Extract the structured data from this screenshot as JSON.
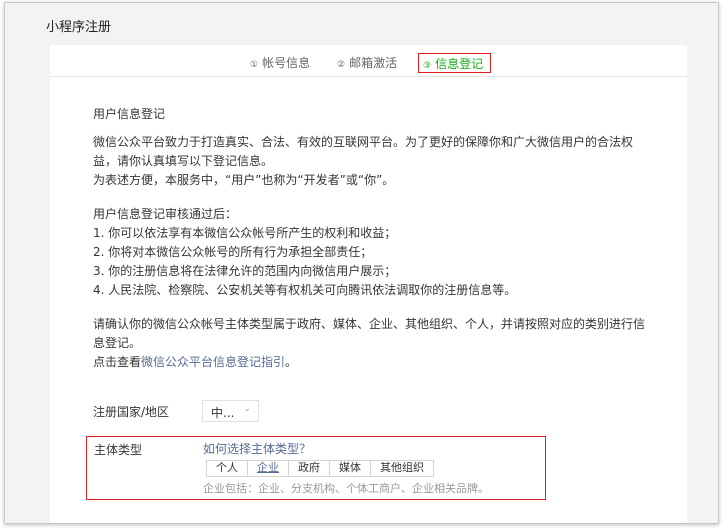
{
  "page": {
    "title": "小程序注册"
  },
  "steps": [
    {
      "num": "①",
      "label": "帐号信息"
    },
    {
      "num": "②",
      "label": "邮箱激活"
    },
    {
      "num": "③",
      "label": "信息登记"
    }
  ],
  "colors": {
    "active_step": "#1aad19",
    "link": "#576b95",
    "highlight_border": "#e02020"
  },
  "intro": {
    "title": "用户信息登记",
    "p1": "微信公众平台致力于打造真实、合法、有效的互联网平台。为了更好的保障你和广大微信用户的合法权益，请你认真填写以下登记信息。",
    "p2": "为表述方便，本服务中，“用户”也称为“开发者”或“你”。",
    "after_title": "用户信息登记审核通过后：",
    "items": [
      "1. 你可以依法享有本微信公众帐号所产生的权利和收益；",
      "2. 你将对本微信公众帐号的所有行为承担全部责任；",
      "3. 你的注册信息将在法律允许的范围内向微信用户展示；",
      "4. 人民法院、检察院、公安机关等有权机关可向腾讯依法调取你的注册信息等。"
    ],
    "confirm": "请确认你的微信公众帐号主体类型属于政府、媒体、企业、其他组织、个人，并请按照对应的类别进行信息登记。",
    "guide_prefix": "点击查看",
    "guide_link": "微信公众平台信息登记指引",
    "guide_suffix": "。"
  },
  "region": {
    "label": "注册国家/地区",
    "value": "中...",
    "icon": "chevron-down-icon"
  },
  "subject": {
    "label": "主体类型",
    "help_link": "如何选择主体类型？",
    "tabs": [
      "个人",
      "企业",
      "政府",
      "媒体",
      "其他组织"
    ],
    "active_tab": "企业",
    "description": "企业包括：企业、分支机构、个体工商户、企业相关品牌。"
  }
}
